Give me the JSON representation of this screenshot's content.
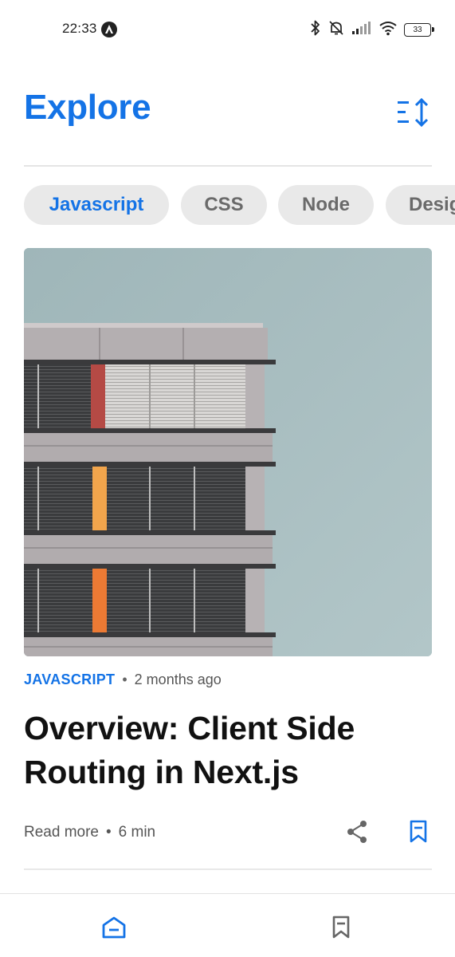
{
  "status_bar": {
    "time": "22:33",
    "battery": "33",
    "icons": [
      "app-notification-icon",
      "bluetooth-icon",
      "silent-bell-icon",
      "signal-icon",
      "wifi-icon",
      "battery-icon"
    ]
  },
  "header": {
    "title": "Explore",
    "sort_icon": "sort-icon"
  },
  "chips": [
    {
      "label": "Javascript",
      "active": true
    },
    {
      "label": "CSS",
      "active": false
    },
    {
      "label": "Node",
      "active": false
    },
    {
      "label": "Design",
      "active": false
    }
  ],
  "article": {
    "category": "JAVASCRIPT",
    "published": "2 months ago",
    "title": "Overview: Client Side Routing in Next.js",
    "read_more": "Read more",
    "read_time": "6 min",
    "separator": "•",
    "image_icon": "building-photo"
  },
  "bottom_nav": {
    "items": [
      {
        "icon": "home-icon",
        "active": true
      },
      {
        "icon": "bookmark-icon",
        "active": false
      }
    ]
  },
  "colors": {
    "accent": "#1473e6",
    "chip_bg": "#e9e9e9",
    "text_muted": "#555555"
  }
}
